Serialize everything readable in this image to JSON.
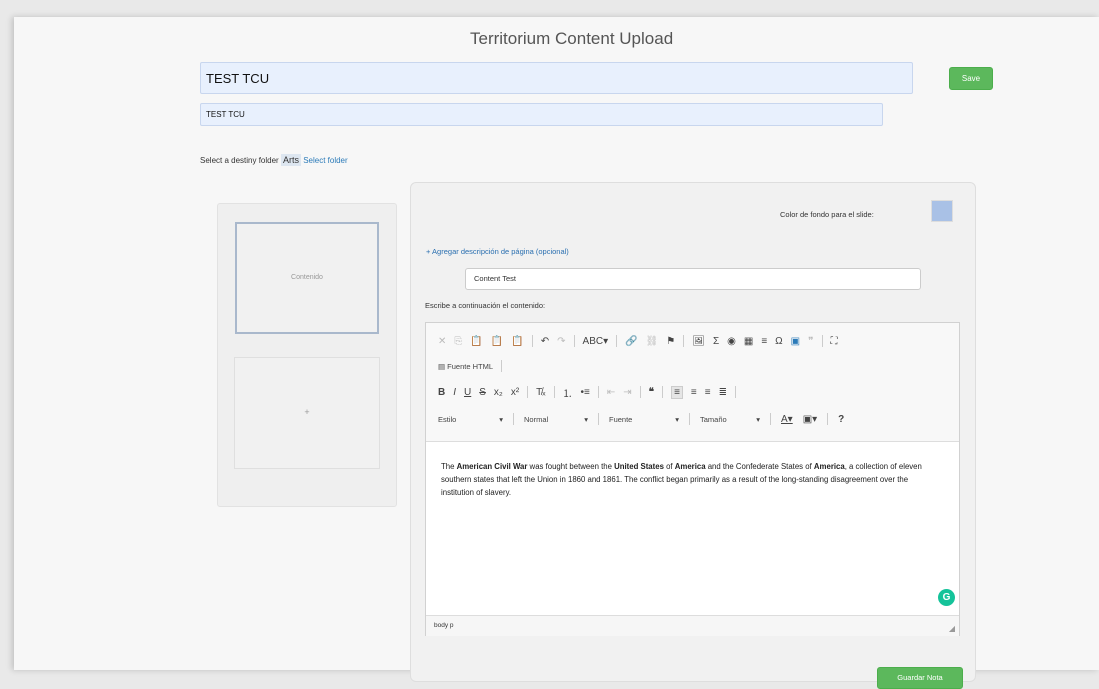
{
  "page": {
    "title": "Territorium Content Upload"
  },
  "form": {
    "title_value": "TEST TCU",
    "subtitle_value": "TEST TCU",
    "save_label": "Save"
  },
  "folder": {
    "label": "Select a destiny folder",
    "current": "Arts",
    "select_link": "Select folder"
  },
  "slides": {
    "items": [
      {
        "label": "Contenido",
        "active": true
      },
      {
        "label": "+",
        "active": false
      }
    ],
    "close_glyph": "×",
    "drag_glyph": "⇅"
  },
  "panel": {
    "bg_label": "Color de fondo para el slide:",
    "bg_color": "#a9c1e6",
    "add_description": "+ Agregar descripción de página (opcional)",
    "description_value": "Content Test",
    "content_label": "Escribe a continuación el contenido:",
    "save_note": "Guardar Nota"
  },
  "toolbar": {
    "source_label": "Fuente HTML",
    "style_combo": "Estilo",
    "format_combo": "Normal",
    "font_combo": "Fuente",
    "size_combo": "Tamaño",
    "help": "?"
  },
  "editor": {
    "segments": [
      {
        "text": "The ",
        "bold": false
      },
      {
        "text": "American Civil War",
        "bold": true
      },
      {
        "text": " was fought between the ",
        "bold": false
      },
      {
        "text": "United States",
        "bold": true
      },
      {
        "text": " of ",
        "bold": false
      },
      {
        "text": "America",
        "bold": true
      },
      {
        "text": " and the Confederate States of ",
        "bold": false
      },
      {
        "text": "America",
        "bold": true
      },
      {
        "text": ", a collection of eleven southern states that left the Union in 1860 and 1861. The conflict began primarily as a result of the long-standing disagreement over the institution of slavery.",
        "bold": false
      }
    ],
    "path": "body  p",
    "grammarly_icon": "G"
  }
}
